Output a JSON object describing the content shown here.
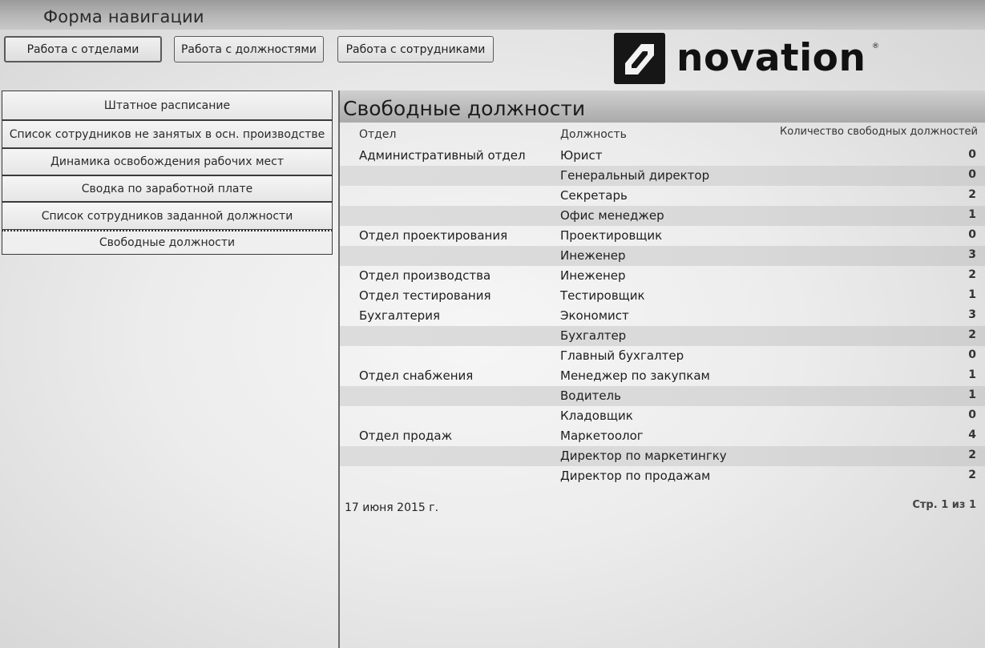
{
  "window": {
    "title": "Форма навигации"
  },
  "toolbar": {
    "departments": "Работа с отделами",
    "positions": "Работа с должностями",
    "employees": "Работа с сотрудниками"
  },
  "logo": {
    "text": "novation",
    "reg": "®"
  },
  "nav": {
    "items": [
      {
        "label": "Штатное расписание"
      },
      {
        "label": "Список сотрудников не занятых в осн. производстве"
      },
      {
        "label": "Динамика освобождения рабочих мест"
      },
      {
        "label": "Сводка по заработной плате"
      },
      {
        "label": "Список сотрудников заданной должности"
      },
      {
        "label": "Свободные должности",
        "selected": true
      }
    ]
  },
  "report": {
    "title": "Свободные должности",
    "columns": {
      "dept": "Отдел",
      "position": "Должность",
      "count": "Количество свободных должностей"
    },
    "rows": [
      {
        "dept": "Административный отдел",
        "position": "Юрист",
        "count": "0"
      },
      {
        "dept": "",
        "position": "Генеральный директор",
        "count": "0"
      },
      {
        "dept": "",
        "position": "Секретарь",
        "count": "2"
      },
      {
        "dept": "",
        "position": "Офис менеджер",
        "count": "1"
      },
      {
        "dept": "Отдел проектирования",
        "position": "Проектировщик",
        "count": "0"
      },
      {
        "dept": "",
        "position": "Инеженер",
        "count": "3"
      },
      {
        "dept": "Отдел производства",
        "position": "Инеженер",
        "count": "2"
      },
      {
        "dept": "Отдел тестирования",
        "position": "Тестировщик",
        "count": "1"
      },
      {
        "dept": "Бухгалтерия",
        "position": "Экономист",
        "count": "3"
      },
      {
        "dept": "",
        "position": "Бухгалтер",
        "count": "2"
      },
      {
        "dept": "",
        "position": "Главный бухгалтер",
        "count": "0"
      },
      {
        "dept": "Отдел снабжения",
        "position": "Менеджер по закупкам",
        "count": "1"
      },
      {
        "dept": "",
        "position": "Водитель",
        "count": "1"
      },
      {
        "dept": "",
        "position": "Кладовщик",
        "count": "0"
      },
      {
        "dept": "Отдел продаж",
        "position": "Маркетоолог",
        "count": "4"
      },
      {
        "dept": "",
        "position": "Директор по маркетингку",
        "count": "2"
      },
      {
        "dept": "",
        "position": "Директор по продажам",
        "count": "2"
      }
    ],
    "shaded_rows": [
      1,
      3,
      5,
      9,
      12,
      15
    ],
    "date": "17 июня 2015 г.",
    "page": "Стр. 1 из 1"
  }
}
